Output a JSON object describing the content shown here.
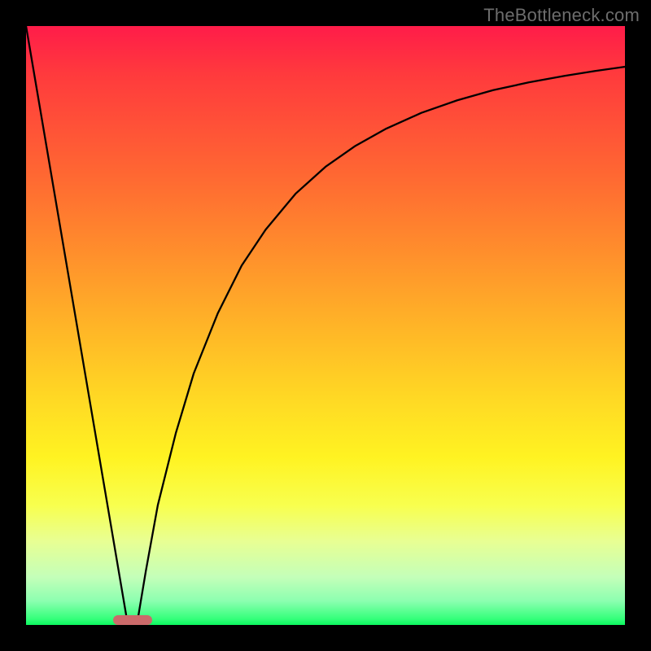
{
  "watermark": "TheBottleneck.com",
  "chart_data": {
    "type": "line",
    "title": "",
    "xlabel": "",
    "ylabel": "",
    "xlim": [
      0,
      100
    ],
    "ylim": [
      0,
      100
    ],
    "series": [
      {
        "name": "left-segment",
        "x": [
          0,
          17
        ],
        "y": [
          100,
          0
        ]
      },
      {
        "name": "right-segment",
        "x": [
          18.5,
          20,
          22,
          25,
          28,
          32,
          36,
          40,
          45,
          50,
          55,
          60,
          66,
          72,
          78,
          84,
          90,
          95,
          100
        ],
        "y": [
          0,
          9,
          20,
          32,
          42,
          52,
          60,
          66,
          72,
          76.5,
          80,
          82.8,
          85.5,
          87.6,
          89.3,
          90.6,
          91.7,
          92.5,
          93.2
        ]
      }
    ],
    "marker": {
      "name": "highlight-bar",
      "x_center": 17.8,
      "width": 6.5,
      "y": 0,
      "height": 1.6,
      "color": "#cb6a6a"
    },
    "background": {
      "type": "vertical-gradient",
      "stops": [
        {
          "pos": 0,
          "color": "#ff1c49"
        },
        {
          "pos": 25,
          "color": "#ff6832"
        },
        {
          "pos": 50,
          "color": "#ffb427"
        },
        {
          "pos": 72,
          "color": "#fff322"
        },
        {
          "pos": 92,
          "color": "#c4ffb9"
        },
        {
          "pos": 100,
          "color": "#0bf75e"
        }
      ]
    }
  }
}
